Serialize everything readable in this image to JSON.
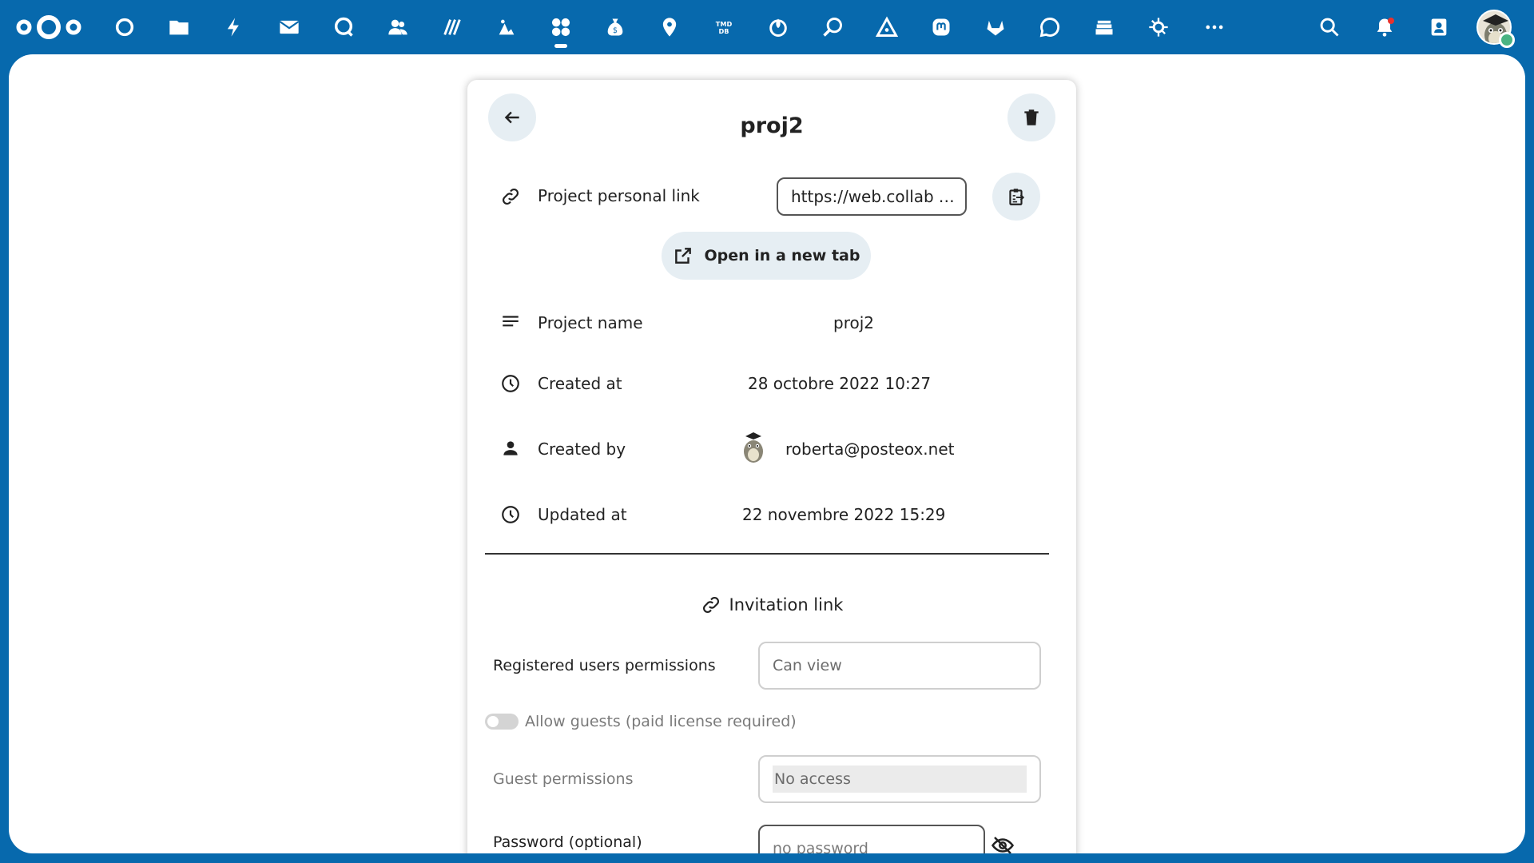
{
  "topbar": {
    "apps": [
      {
        "name": "dashboard"
      },
      {
        "name": "files"
      },
      {
        "name": "activity"
      },
      {
        "name": "mail"
      },
      {
        "name": "talk"
      },
      {
        "name": "contacts"
      },
      {
        "name": "notes"
      },
      {
        "name": "cospend"
      },
      {
        "name": "integration",
        "active": true
      },
      {
        "name": "budget"
      },
      {
        "name": "maps"
      },
      {
        "name": "tmdb"
      },
      {
        "name": "deck"
      },
      {
        "name": "search-apps"
      },
      {
        "name": "drive"
      },
      {
        "name": "mastodon"
      },
      {
        "name": "gitlab"
      },
      {
        "name": "chat"
      },
      {
        "name": "stack"
      },
      {
        "name": "openproject"
      },
      {
        "name": "more"
      }
    ],
    "accent": "#0769ad"
  },
  "project": {
    "title": "proj2",
    "personal_link_label": "Project personal link",
    "personal_link_value": "https://web.collab",
    "personal_link_ellipsis": "…",
    "open_new_tab_label": "Open in a new tab",
    "name_label": "Project name",
    "name_value": "proj2",
    "created_at_label": "Created at",
    "created_at_value": "28 octobre 2022 10:27",
    "created_by_label": "Created by",
    "created_by_value": "roberta@posteox.net",
    "updated_at_label": "Updated at",
    "updated_at_value": "22 novembre 2022 15:29"
  },
  "invitation": {
    "title": "Invitation link",
    "registered_label": "Registered users permissions",
    "registered_value": "Can view",
    "allow_guests_label": "Allow guests (paid license required)",
    "allow_guests_on": false,
    "guest_label": "Guest permissions",
    "guest_value": "No access",
    "password_label": "Password (optional)",
    "password_placeholder": "no password"
  }
}
